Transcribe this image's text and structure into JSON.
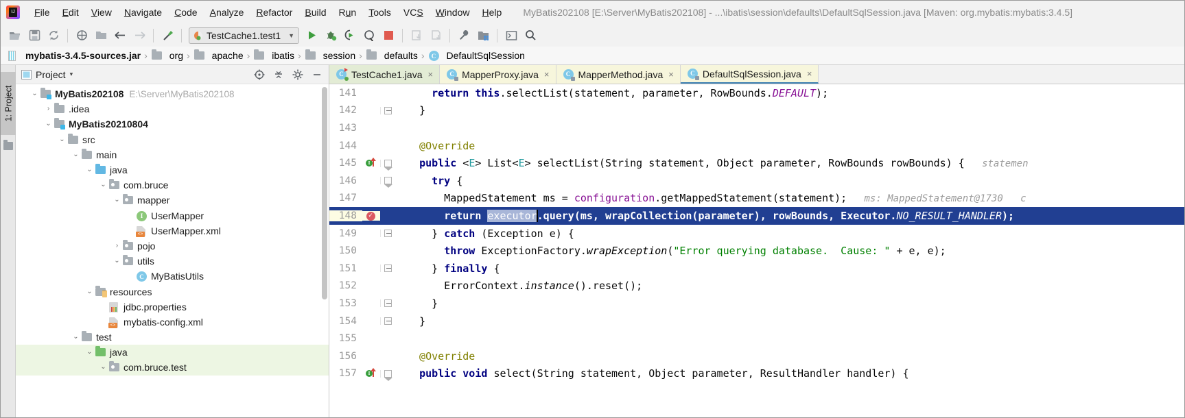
{
  "window": {
    "title": "MyBatis202108 [E:\\Server\\MyBatis202108] - ...\\ibatis\\session\\defaults\\DefaultSqlSession.java [Maven: org.mybatis:mybatis:3.4.5]",
    "logo_text": "IJ"
  },
  "menubar": {
    "items": [
      {
        "label": "File",
        "mnemonic": "F"
      },
      {
        "label": "Edit",
        "mnemonic": "E"
      },
      {
        "label": "View",
        "mnemonic": "V"
      },
      {
        "label": "Navigate",
        "mnemonic": "N"
      },
      {
        "label": "Code",
        "mnemonic": "C"
      },
      {
        "label": "Analyze",
        "mnemonic": "A"
      },
      {
        "label": "Refactor",
        "mnemonic": "R"
      },
      {
        "label": "Build",
        "mnemonic": "B"
      },
      {
        "label": "Run",
        "mnemonic": "u"
      },
      {
        "label": "Tools",
        "mnemonic": "T"
      },
      {
        "label": "VCS",
        "mnemonic": "S"
      },
      {
        "label": "Window",
        "mnemonic": "W"
      },
      {
        "label": "Help",
        "mnemonic": "H"
      }
    ]
  },
  "toolbar": {
    "open_label": "Open",
    "save_label": "Save All",
    "sync_label": "Synchronize",
    "bug_label": "Toggle Debug",
    "module_label": "Project Structure",
    "back_label": "Back",
    "forward_label": "Forward",
    "build_label": "Build Project",
    "run_config": "TestCache1.test1",
    "run_label": "Run",
    "debug_label": "Debug",
    "run_coverage_label": "Run with Coverage",
    "profile_label": "Profile",
    "stop_label": "Stop",
    "update_label": "Update Project",
    "commit_label": "Commit",
    "settings_label": "Settings",
    "structure_label": "Project Structure Dialog",
    "terminal_label": "Terminal",
    "search_label": "Search Everywhere"
  },
  "breadcrumb": {
    "items": [
      {
        "label": "mybatis-3.4.5-sources.jar",
        "icon": "jar-icon",
        "bold": true
      },
      {
        "label": "org",
        "icon": "folder-icon",
        "bold": false
      },
      {
        "label": "apache",
        "icon": "folder-icon",
        "bold": false
      },
      {
        "label": "ibatis",
        "icon": "folder-icon",
        "bold": false
      },
      {
        "label": "session",
        "icon": "folder-icon",
        "bold": false
      },
      {
        "label": "defaults",
        "icon": "folder-icon",
        "bold": false
      },
      {
        "label": "DefaultSqlSession",
        "icon": "class-icon",
        "bold": false
      }
    ],
    "separator": "›"
  },
  "left_rail": {
    "project_tab": "1: Project",
    "structure_icon": "module-icon"
  },
  "project_panel": {
    "title": "Project",
    "caret": "▾",
    "actions": [
      {
        "name": "locate-icon",
        "label": "Select Opened File"
      },
      {
        "name": "collapse-all-icon",
        "label": "Collapse All"
      },
      {
        "name": "gear-icon",
        "label": "Settings"
      },
      {
        "name": "hide-icon",
        "label": "Hide"
      }
    ],
    "tree": [
      {
        "indent": 0,
        "twist": "⌄",
        "icon": "folder-module-icon",
        "label": "MyBatis202108",
        "bold": true,
        "path": "E:\\Server\\MyBatis202108",
        "selected": false
      },
      {
        "indent": 1,
        "twist": "›",
        "icon": "folder-icon",
        "label": ".idea",
        "bold": false,
        "path": "",
        "selected": false
      },
      {
        "indent": 1,
        "twist": "⌄",
        "icon": "folder-module-icon",
        "label": "MyBatis20210804",
        "bold": true,
        "path": "",
        "selected": false
      },
      {
        "indent": 2,
        "twist": "⌄",
        "icon": "folder-icon",
        "label": "src",
        "bold": false,
        "path": "",
        "selected": false
      },
      {
        "indent": 3,
        "twist": "⌄",
        "icon": "folder-icon",
        "label": "main",
        "bold": false,
        "path": "",
        "selected": false
      },
      {
        "indent": 4,
        "twist": "⌄",
        "icon": "folder-source-icon",
        "label": "java",
        "bold": false,
        "path": "",
        "selected": false
      },
      {
        "indent": 5,
        "twist": "⌄",
        "icon": "package-icon",
        "label": "com.bruce",
        "bold": false,
        "path": "",
        "selected": false
      },
      {
        "indent": 6,
        "twist": "⌄",
        "icon": "package-icon",
        "label": "mapper",
        "bold": false,
        "path": "",
        "selected": false
      },
      {
        "indent": 7,
        "twist": "",
        "icon": "interface-icon",
        "label": "UserMapper",
        "bold": false,
        "path": "",
        "selected": false
      },
      {
        "indent": 7,
        "twist": "",
        "icon": "xml-icon",
        "label": "UserMapper.xml",
        "bold": false,
        "path": "",
        "selected": false
      },
      {
        "indent": 6,
        "twist": "›",
        "icon": "package-icon",
        "label": "pojo",
        "bold": false,
        "path": "",
        "selected": false
      },
      {
        "indent": 6,
        "twist": "⌄",
        "icon": "package-icon",
        "label": "utils",
        "bold": false,
        "path": "",
        "selected": false
      },
      {
        "indent": 7,
        "twist": "",
        "icon": "class-icon",
        "label": "MyBatisUtils",
        "bold": false,
        "path": "",
        "selected": false
      },
      {
        "indent": 4,
        "twist": "⌄",
        "icon": "folder-resource-icon",
        "label": "resources",
        "bold": false,
        "path": "",
        "selected": false
      },
      {
        "indent": 5,
        "twist": "",
        "icon": "properties-icon",
        "label": "jdbc.properties",
        "bold": false,
        "path": "",
        "selected": false
      },
      {
        "indent": 5,
        "twist": "",
        "icon": "xml-icon",
        "label": "mybatis-config.xml",
        "bold": false,
        "path": "",
        "selected": false
      },
      {
        "indent": 3,
        "twist": "⌄",
        "icon": "folder-icon",
        "label": "test",
        "bold": false,
        "path": "",
        "selected": false
      },
      {
        "indent": 4,
        "twist": "⌄",
        "icon": "folder-test-icon",
        "label": "java",
        "bold": false,
        "path": "",
        "selected": true
      },
      {
        "indent": 5,
        "twist": "⌄",
        "icon": "package-icon",
        "label": "com.bruce.test",
        "bold": false,
        "path": "",
        "selected": true
      }
    ]
  },
  "editor": {
    "tabs": [
      {
        "label": "TestCache1.java",
        "icon": "class-run-icon",
        "style": "green",
        "active": false,
        "close": "×"
      },
      {
        "label": "MapperProxy.java",
        "icon": "class-lock-icon",
        "style": "yellow",
        "active": false,
        "close": "×"
      },
      {
        "label": "MapperMethod.java",
        "icon": "class-lock-icon",
        "style": "yellow",
        "active": false,
        "close": "×"
      },
      {
        "label": "DefaultSqlSession.java",
        "icon": "class-lock-icon",
        "style": "yellow",
        "active": true,
        "close": "×"
      }
    ],
    "lines": [
      {
        "num": "141",
        "fold": "",
        "marker": "",
        "highlight": false,
        "tokens": [
          {
            "t": "    ",
            "c": "plain"
          },
          {
            "t": "return ",
            "c": "kw"
          },
          {
            "t": "this",
            "c": "kw"
          },
          {
            "t": ".selectList(statement, parameter, RowBounds.",
            "c": "plain"
          },
          {
            "t": "DEFAULT",
            "c": "field static-it"
          },
          {
            "t": ");",
            "c": "plain"
          }
        ],
        "hint": ""
      },
      {
        "num": "142",
        "fold": "minus",
        "marker": "",
        "highlight": false,
        "tokens": [
          {
            "t": "  }",
            "c": "plain"
          }
        ],
        "hint": ""
      },
      {
        "num": "143",
        "fold": "",
        "marker": "",
        "highlight": false,
        "tokens": [],
        "hint": ""
      },
      {
        "num": "144",
        "fold": "",
        "marker": "",
        "highlight": false,
        "tokens": [
          {
            "t": "  @Override",
            "c": "anno"
          }
        ],
        "hint": ""
      },
      {
        "num": "145",
        "fold": "down",
        "marker": "implemented",
        "highlight": false,
        "tokens": [
          {
            "t": "  ",
            "c": "plain"
          },
          {
            "t": "public ",
            "c": "kw"
          },
          {
            "t": "<",
            "c": "plain"
          },
          {
            "t": "E",
            "c": "type-e"
          },
          {
            "t": "> List<",
            "c": "plain"
          },
          {
            "t": "E",
            "c": "type-e"
          },
          {
            "t": "> selectList(String statement, Object parameter, RowBounds rowBounds) {",
            "c": "plain"
          }
        ],
        "hint": "statemen"
      },
      {
        "num": "146",
        "fold": "down",
        "marker": "",
        "highlight": false,
        "tokens": [
          {
            "t": "    ",
            "c": "plain"
          },
          {
            "t": "try ",
            "c": "kw"
          },
          {
            "t": "{",
            "c": "plain"
          }
        ],
        "hint": ""
      },
      {
        "num": "147",
        "fold": "",
        "marker": "",
        "highlight": false,
        "tokens": [
          {
            "t": "      MappedStatement ms = ",
            "c": "plain"
          },
          {
            "t": "configuration",
            "c": "field"
          },
          {
            "t": ".getMappedStatement(statement);",
            "c": "plain"
          }
        ],
        "hint": "ms: MappedStatement@1730   c"
      },
      {
        "num": "148",
        "fold": "",
        "marker": "breakpoint",
        "highlight": true,
        "tokens": [
          {
            "t": "      ",
            "c": "plain"
          },
          {
            "t": "return ",
            "c": "kw"
          },
          {
            "t": "executor",
            "c": "sel-token"
          },
          {
            "t": "CARET",
            "c": "caret"
          },
          {
            "t": ".query(ms, wrapCollection(parameter), rowBounds, Executor.",
            "c": "plain"
          },
          {
            "t": "NO_RESULT_HANDLER",
            "c": "static-it"
          },
          {
            "t": ");",
            "c": "plain"
          }
        ],
        "hint": ""
      },
      {
        "num": "149",
        "fold": "minus",
        "marker": "",
        "highlight": false,
        "tokens": [
          {
            "t": "    } ",
            "c": "plain"
          },
          {
            "t": "catch ",
            "c": "kw"
          },
          {
            "t": "(Exception e) {",
            "c": "plain"
          }
        ],
        "hint": ""
      },
      {
        "num": "150",
        "fold": "",
        "marker": "",
        "highlight": false,
        "tokens": [
          {
            "t": "      ",
            "c": "plain"
          },
          {
            "t": "throw ",
            "c": "kw"
          },
          {
            "t": "ExceptionFactory.",
            "c": "plain"
          },
          {
            "t": "wrapException",
            "c": "static-it"
          },
          {
            "t": "(",
            "c": "plain"
          },
          {
            "t": "\"Error querying database.  Cause: \"",
            "c": "str"
          },
          {
            "t": " + e, e);",
            "c": "plain"
          }
        ],
        "hint": ""
      },
      {
        "num": "151",
        "fold": "minus",
        "marker": "",
        "highlight": false,
        "tokens": [
          {
            "t": "    } ",
            "c": "plain"
          },
          {
            "t": "finally ",
            "c": "kw"
          },
          {
            "t": "{",
            "c": "plain"
          }
        ],
        "hint": ""
      },
      {
        "num": "152",
        "fold": "",
        "marker": "",
        "highlight": false,
        "tokens": [
          {
            "t": "      ErrorContext.",
            "c": "plain"
          },
          {
            "t": "instance",
            "c": "static-it"
          },
          {
            "t": "().reset();",
            "c": "plain"
          }
        ],
        "hint": ""
      },
      {
        "num": "153",
        "fold": "minus",
        "marker": "",
        "highlight": false,
        "tokens": [
          {
            "t": "    }",
            "c": "plain"
          }
        ],
        "hint": ""
      },
      {
        "num": "154",
        "fold": "minus",
        "marker": "",
        "highlight": false,
        "tokens": [
          {
            "t": "  }",
            "c": "plain"
          }
        ],
        "hint": ""
      },
      {
        "num": "155",
        "fold": "",
        "marker": "",
        "highlight": false,
        "tokens": [],
        "hint": ""
      },
      {
        "num": "156",
        "fold": "",
        "marker": "",
        "highlight": false,
        "tokens": [
          {
            "t": "  @Override",
            "c": "anno"
          }
        ],
        "hint": ""
      },
      {
        "num": "157",
        "fold": "down",
        "marker": "implemented",
        "highlight": false,
        "tokens": [
          {
            "t": "  ",
            "c": "plain"
          },
          {
            "t": "public void ",
            "c": "kw"
          },
          {
            "t": "select(String statement, Object parameter, ResultHandler handler) {",
            "c": "plain"
          }
        ],
        "hint": ""
      }
    ]
  },
  "colors": {
    "accent_blue": "#213f92",
    "selection_token": "#a8b6d8",
    "tab_active_bg": "#f7f6dc",
    "tab_green_bg": "#e3ecd5",
    "tree_selected_bg": "#edf6e3",
    "keyword": "#000080",
    "string": "#008000",
    "annotation": "#808000",
    "field": "#871094",
    "hint_gray": "#9a9a9a"
  }
}
